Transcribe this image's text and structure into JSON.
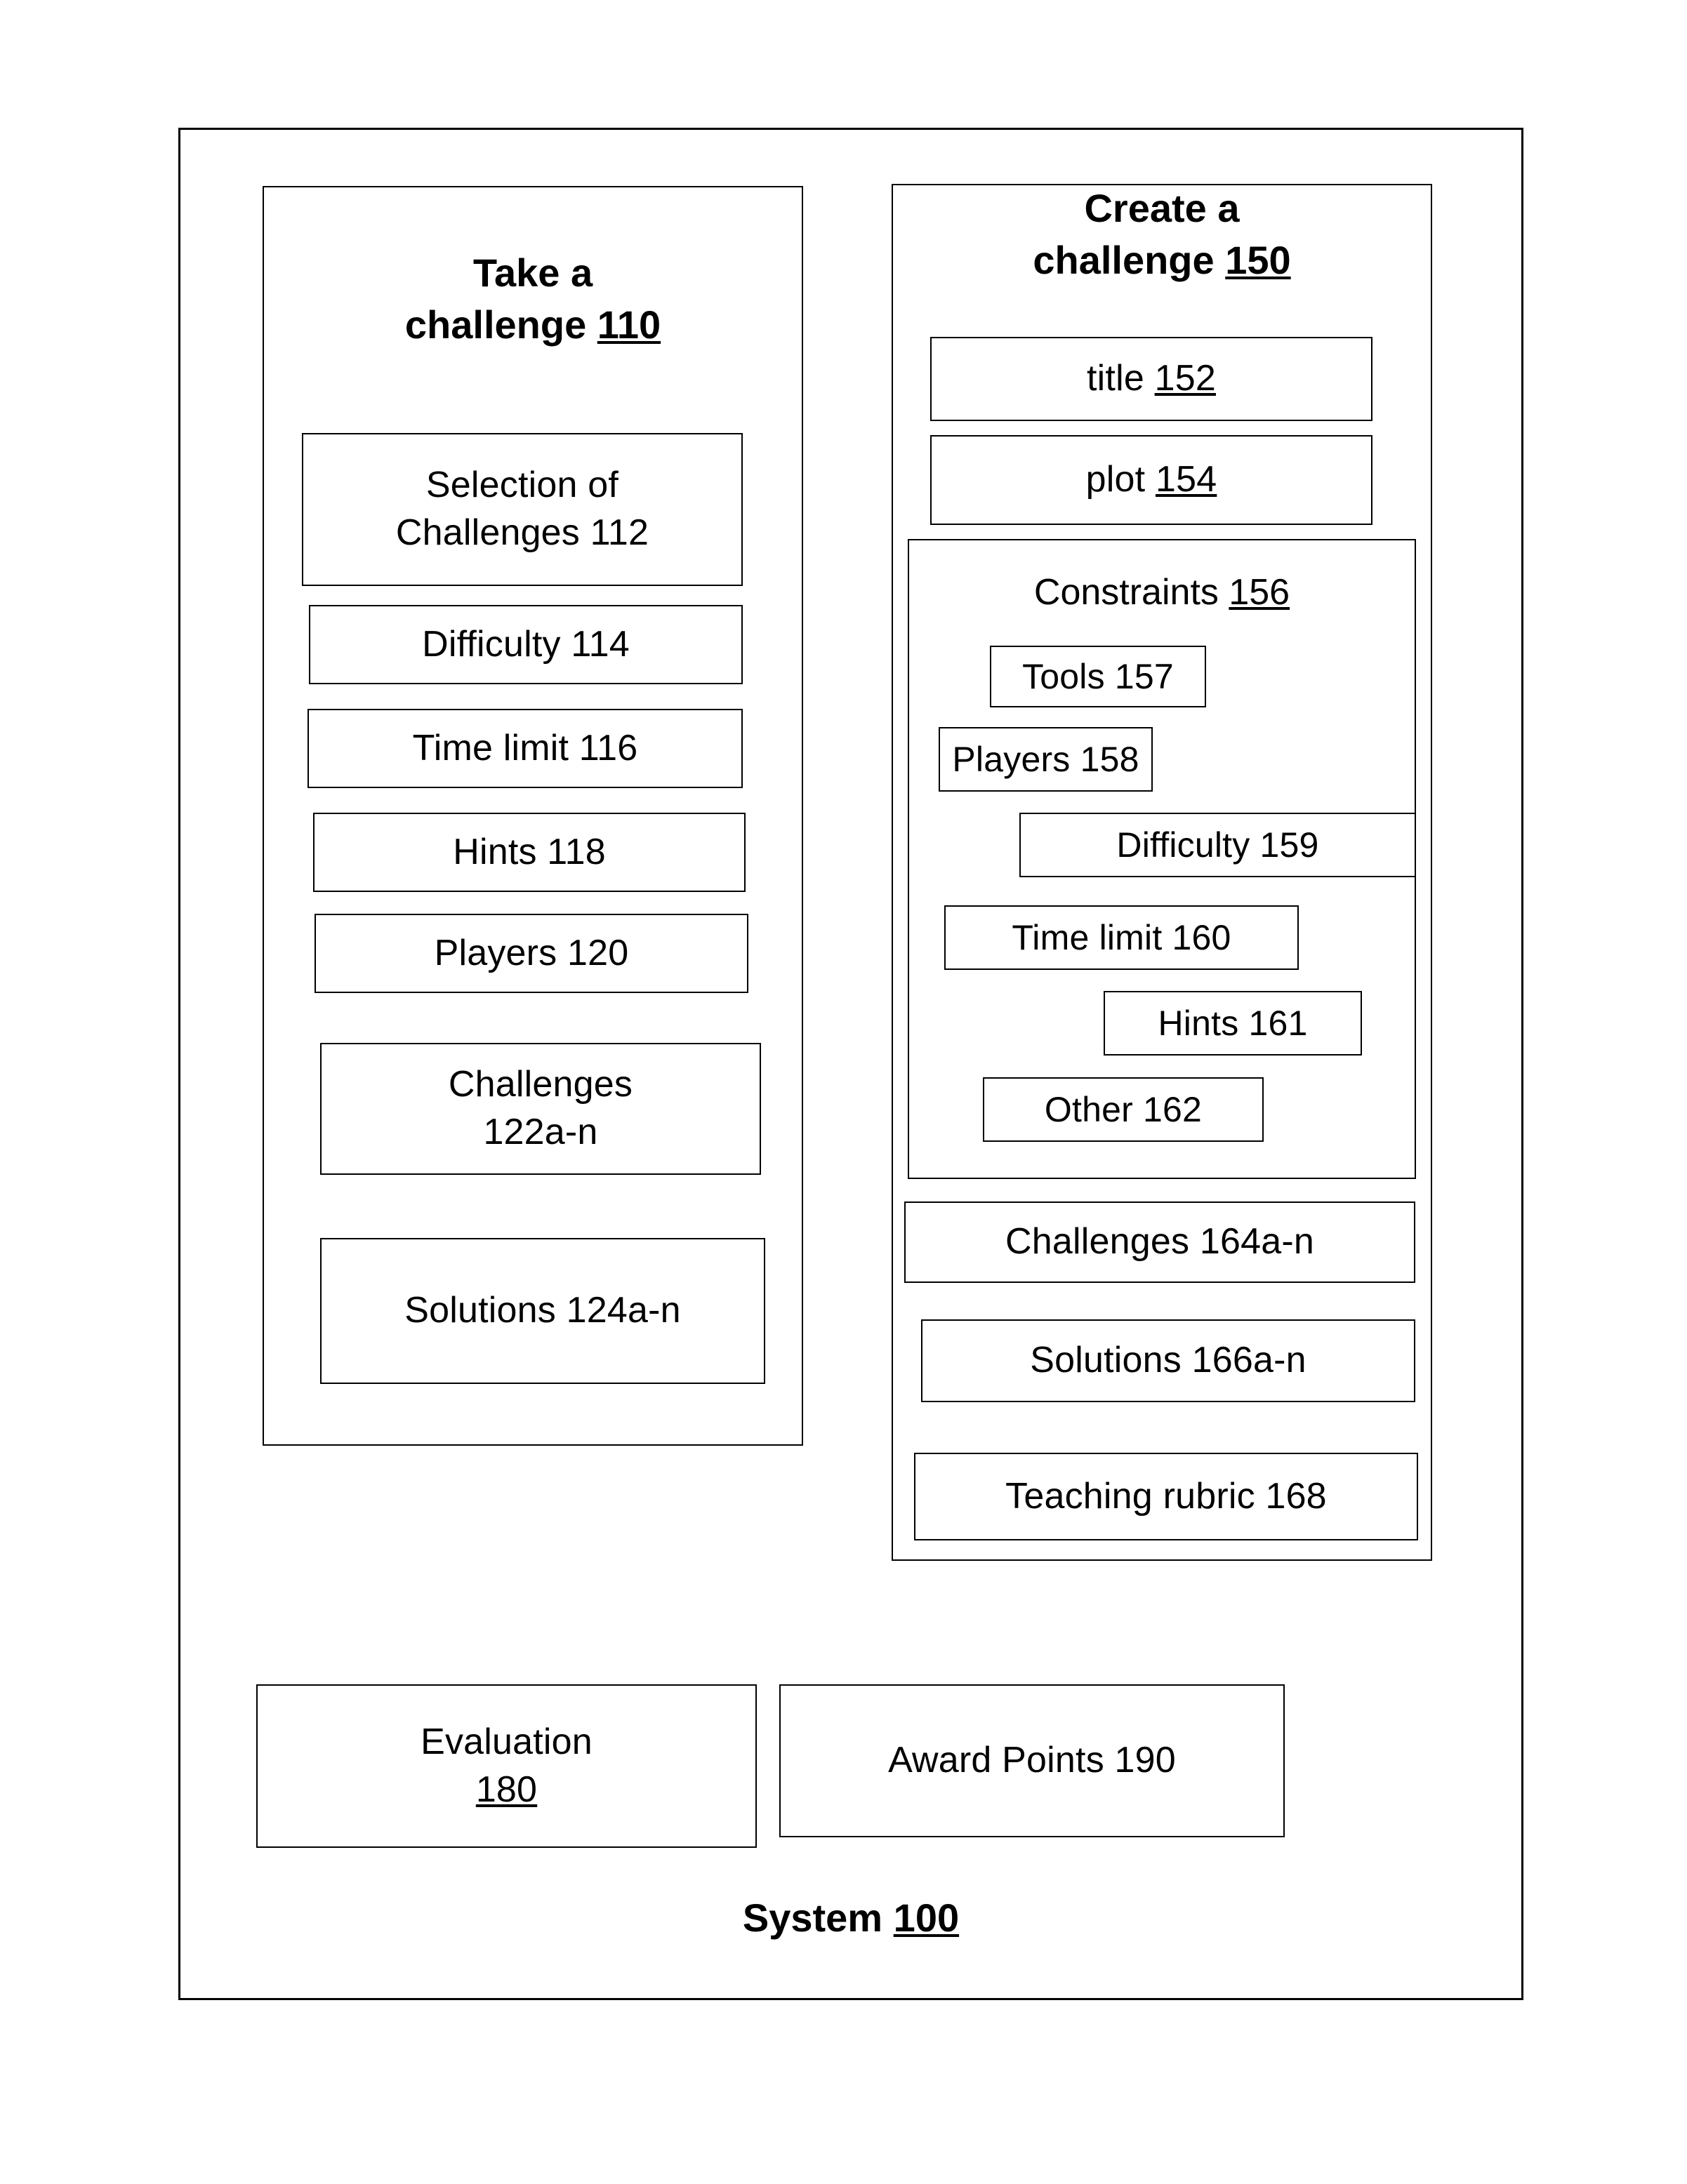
{
  "figure": {
    "system_label": "System ",
    "system_ref": "100"
  },
  "take_challenge": {
    "title_text": "Take a\nchallenge ",
    "title_ref": "110",
    "items": [
      {
        "label": "Selection of\nChallenges 112",
        "ref": "112"
      },
      {
        "label": "Difficulty 114",
        "ref": "114"
      },
      {
        "label": "Time limit 116",
        "ref": "116"
      },
      {
        "label": "Hints 118",
        "ref": "118"
      },
      {
        "label": "Players 120",
        "ref": "120"
      },
      {
        "label": "Challenges\n122a-n",
        "ref": "122a-n"
      },
      {
        "label": "Solutions 124a-n",
        "ref": "124a-n"
      }
    ]
  },
  "create_challenge": {
    "title_text": "Create a\nchallenge ",
    "title_ref": "150",
    "title_field": "title ",
    "title_field_ref": "152",
    "plot_field": "plot ",
    "plot_field_ref": "154",
    "constraints": {
      "heading": "Constraints ",
      "heading_ref": "156",
      "items": [
        {
          "label": "Tools 157",
          "ref": "157"
        },
        {
          "label": "Players 158",
          "ref": "158"
        },
        {
          "label": "Difficulty 159",
          "ref": "159"
        },
        {
          "label": "Time limit 160",
          "ref": "160"
        },
        {
          "label": "Hints 161",
          "ref": "161"
        },
        {
          "label": "Other 162",
          "ref": "162"
        }
      ]
    },
    "outputs": [
      {
        "label": "Challenges 164a-n",
        "ref": "164a-n"
      },
      {
        "label": "Solutions 166a-n",
        "ref": "166a-n"
      },
      {
        "label": "Teaching rubric 168",
        "ref": "168"
      }
    ]
  },
  "bottom": {
    "evaluation_label": "Evaluation\n",
    "evaluation_ref": "180",
    "award_points_label": "Award Points 190",
    "award_points_ref": "190"
  }
}
